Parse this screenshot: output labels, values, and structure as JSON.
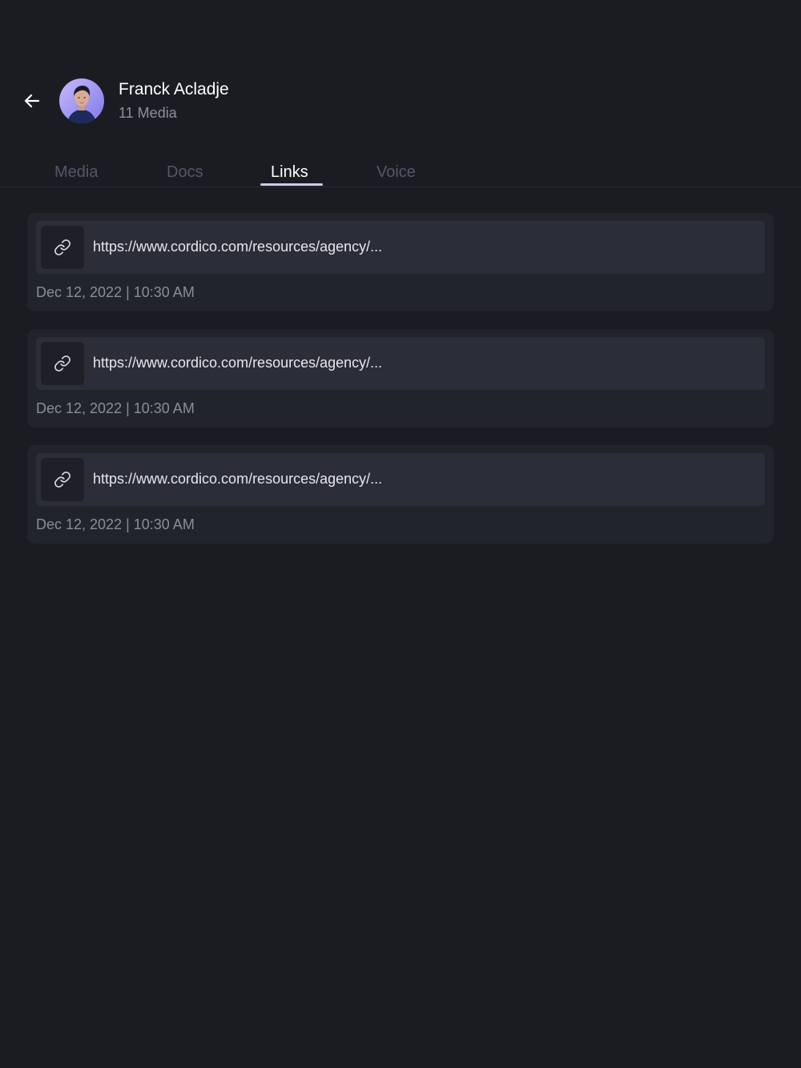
{
  "contact": {
    "name": "Franck Acladje",
    "subtitle": "11 Media"
  },
  "tabs": [
    {
      "label": "Media",
      "active": false
    },
    {
      "label": "Docs",
      "active": false
    },
    {
      "label": "Links",
      "active": true
    },
    {
      "label": "Voice",
      "active": false
    }
  ],
  "links": [
    {
      "url": "https://www.cordico.com/resources/agency/...",
      "date": "Dec 12, 2022 | 10:30 AM",
      "icon": "link-icon"
    },
    {
      "url": "https://www.cordico.com/resources/agency/...",
      "date": "Dec 12, 2022 | 10:30 AM",
      "icon": "link-icon"
    },
    {
      "url": "https://www.cordico.com/resources/agency/...",
      "date": "Dec 12, 2022 | 10:30 AM",
      "icon": "link-icon"
    }
  ],
  "icons": {
    "back": "arrow-left-icon",
    "link": "link-icon"
  },
  "colors": {
    "background": "#1b1c21",
    "card": "#22242c",
    "link_row": "#2b2d39",
    "tab_inactive": "#52566a",
    "tab_active": "#ffffff",
    "tab_underline": "#c9ccf5",
    "muted_text": "#8a8d99"
  }
}
